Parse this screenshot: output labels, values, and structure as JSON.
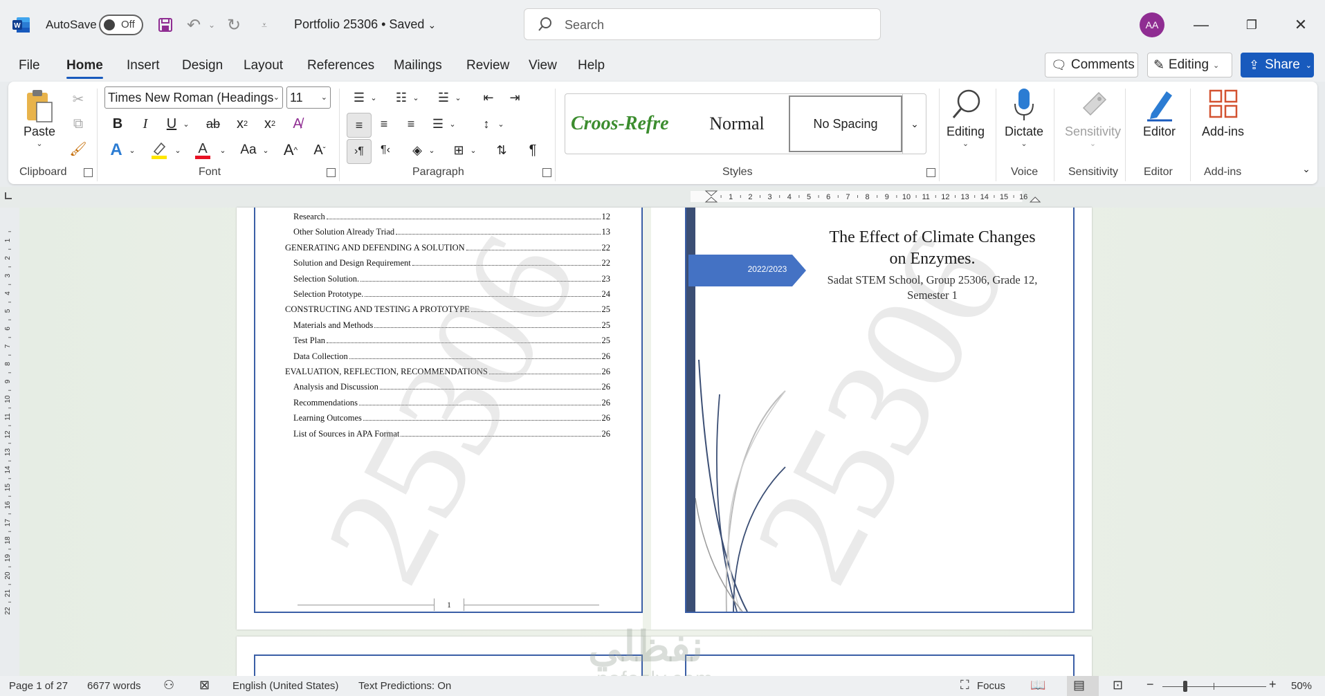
{
  "titlebar": {
    "autosave_label": "AutoSave",
    "autosave_state": "Off",
    "doc_title": "Portfolio 25306 • Saved",
    "search_placeholder": "Search",
    "avatar_initials": "AA"
  },
  "tabs": [
    "File",
    "Home",
    "Insert",
    "Design",
    "Layout",
    "References",
    "Mailings",
    "Review",
    "View",
    "Help"
  ],
  "active_tab": "Home",
  "header_buttons": {
    "comments": "Comments",
    "editing": "Editing",
    "share": "Share"
  },
  "ribbon": {
    "clipboard": {
      "paste": "Paste",
      "label": "Clipboard"
    },
    "font": {
      "name": "Times New Roman (Headings",
      "size": "11",
      "label": "Font"
    },
    "paragraph": {
      "label": "Paragraph"
    },
    "styles": {
      "items": [
        "Croos-Refre",
        "Normal",
        "No Spacing"
      ],
      "label": "Styles"
    },
    "editing": {
      "label": "Editing"
    },
    "voice": {
      "dictate": "Dictate",
      "label": "Voice"
    },
    "sensitivity": {
      "button": "Sensitivity",
      "label": "Sensitivity"
    },
    "editor": {
      "button": "Editor",
      "label": "Editor"
    },
    "addins": {
      "button": "Add-ins",
      "label": "Add-ins"
    }
  },
  "ruler": {
    "h_numbers": [
      "1",
      "2",
      "3",
      "4",
      "5",
      "6",
      "7",
      "8",
      "9",
      "10",
      "11",
      "12",
      "13",
      "14",
      "15",
      "16"
    ],
    "v_numbers": [
      "1",
      "2",
      "3",
      "4",
      "5",
      "6",
      "7",
      "8",
      "9",
      "10",
      "11",
      "12",
      "13",
      "14",
      "15",
      "16",
      "17",
      "18",
      "19",
      "20",
      "21",
      "22"
    ]
  },
  "toc": [
    {
      "text": "Research",
      "page": "12",
      "indent": 1
    },
    {
      "text": "Other Solution Already Triad",
      "page": "13",
      "indent": 1
    },
    {
      "text": "GENERATING AND DEFENDING A SOLUTION",
      "page": "22",
      "indent": 0
    },
    {
      "text": "Solution and Design Requirement",
      "page": "22",
      "indent": 1
    },
    {
      "text": "Selection Solution.",
      "page": "23",
      "indent": 1
    },
    {
      "text": "Selection Prototype.",
      "page": "24",
      "indent": 1
    },
    {
      "text": "CONSTRUCTING AND TESTING A PROTOTYPE",
      "page": "25",
      "indent": 0
    },
    {
      "text": "Materials and Methods",
      "page": "25",
      "indent": 1
    },
    {
      "text": "Test Plan",
      "page": "25",
      "indent": 1
    },
    {
      "text": "Data Collection",
      "page": "26",
      "indent": 1
    },
    {
      "text": "EVALUATION, REFLECTION, RECOMMENDATIONS",
      "page": "26",
      "indent": 0
    },
    {
      "text": "Analysis and Discussion",
      "page": "26",
      "indent": 1
    },
    {
      "text": "Recommendations",
      "page": "26",
      "indent": 1
    },
    {
      "text": "Learning Outcomes",
      "page": "26",
      "indent": 1
    },
    {
      "text": "List of Sources in APA Format",
      "page": "26",
      "indent": 1
    }
  ],
  "page_number": "1",
  "watermark": "25306",
  "cover": {
    "year_tag": "2022/2023",
    "title": "The Effect of Climate Changes on Enzymes.",
    "subtitle": "Sadat STEM School, Group 25306, Grade 12, Semester 1"
  },
  "statusbar": {
    "page": "Page 1 of 27",
    "words": "6677 words",
    "language": "English (United States)",
    "predictions": "Text Predictions: On",
    "focus": "Focus",
    "zoom": "50%"
  },
  "overlay_brand": {
    "arabic": "نفظلي",
    "latin": "nafezly.com"
  },
  "colors": {
    "accent": "#185abd",
    "page_border": "#3a5ea6",
    "cover_tag": "#4472c4",
    "cover_bar": "#3b4e74",
    "style_green": "#3c8d2f"
  }
}
